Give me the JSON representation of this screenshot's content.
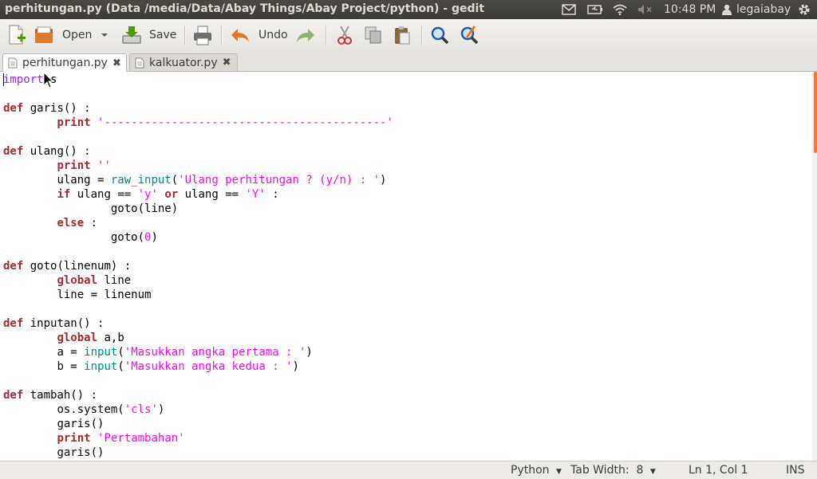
{
  "window": {
    "title": "perhitungan.py (Data /media/Data/Abay Things/Abay Project/python) - gedit"
  },
  "panel": {
    "icons": [
      "mail-icon",
      "battery-icon",
      "wifi-icon",
      "volume-muted-icon"
    ],
    "clock": "10:48 PM",
    "user": "legaiabay",
    "power_icon": "gear-icon"
  },
  "toolbar": {
    "new_icon": "new-document-icon",
    "open_label": "Open",
    "open_icon": "open-folder-icon",
    "save_label": "Save",
    "save_icon": "save-icon",
    "print_icon": "print-icon",
    "undo_label": "Undo",
    "undo_icon": "undo-arrow-icon",
    "redo_icon": "redo-arrow-icon",
    "cut_icon": "cut-icon",
    "copy_icon": "copy-icon",
    "paste_icon": "paste-icon",
    "find_icon": "find-icon",
    "replace_icon": "find-replace-icon"
  },
  "tabs": [
    {
      "label": "perhitungan.py",
      "active": true
    },
    {
      "label": "kalkuator.py",
      "active": false
    }
  ],
  "editor": {
    "lines": [
      [
        [
          "imp",
          "import"
        ],
        [
          "",
          "os"
        ]
      ],
      [],
      [
        [
          "kw",
          "def"
        ],
        [
          "",
          " garis() :"
        ]
      ],
      [
        [
          "",
          " "
        ],
        [
          "kw",
          "print"
        ],
        [
          "",
          " "
        ],
        [
          "str",
          "'------------------------------------------'"
        ]
      ],
      [],
      [
        [
          "kw",
          "def"
        ],
        [
          "",
          " ulang() :"
        ]
      ],
      [
        [
          "",
          " "
        ],
        [
          "kw",
          "print"
        ],
        [
          "",
          " "
        ],
        [
          "str",
          "''"
        ]
      ],
      [
        [
          "",
          " ulang = "
        ],
        [
          "bi",
          "raw_input"
        ],
        [
          "",
          "("
        ],
        [
          "str",
          "'Ulang perhitungan ? (y/n) : '"
        ],
        [
          "",
          ")"
        ]
      ],
      [
        [
          "",
          " "
        ],
        [
          "kw",
          "if"
        ],
        [
          "",
          " ulang == "
        ],
        [
          "str",
          "'y'"
        ],
        [
          "",
          " "
        ],
        [
          "kw",
          "or"
        ],
        [
          "",
          " ulang == "
        ],
        [
          "str",
          "'Y'"
        ],
        [
          "",
          " :"
        ]
      ],
      [
        [
          "",
          " goto(line)"
        ]
      ],
      [
        [
          "",
          " "
        ],
        [
          "kw",
          "else"
        ],
        [
          "",
          " :"
        ]
      ],
      [
        [
          "",
          " goto("
        ],
        [
          "num",
          "0"
        ],
        [
          "",
          ")"
        ]
      ],
      [],
      [
        [
          "kw",
          "def"
        ],
        [
          "",
          " goto(linenum) :"
        ]
      ],
      [
        [
          "",
          " "
        ],
        [
          "kw",
          "global"
        ],
        [
          "",
          " line"
        ]
      ],
      [
        [
          "",
          " line = linenum"
        ]
      ],
      [],
      [
        [
          "kw",
          "def"
        ],
        [
          "",
          " inputan() :"
        ]
      ],
      [
        [
          "",
          " "
        ],
        [
          "kw",
          "global"
        ],
        [
          "",
          " a,b"
        ]
      ],
      [
        [
          "",
          " a = "
        ],
        [
          "bi",
          "input"
        ],
        [
          "",
          "("
        ],
        [
          "str",
          "'Masukkan angka pertama : '"
        ],
        [
          "",
          ")"
        ]
      ],
      [
        [
          "",
          " b = "
        ],
        [
          "bi",
          "input"
        ],
        [
          "",
          "("
        ],
        [
          "str",
          "'Masukkan angka kedua : '"
        ],
        [
          "",
          ")"
        ]
      ],
      [],
      [
        [
          "kw",
          "def"
        ],
        [
          "",
          " tambah() :"
        ]
      ],
      [
        [
          "",
          " os.system("
        ],
        [
          "str",
          "'cls'"
        ],
        [
          "",
          ")"
        ]
      ],
      [
        [
          "",
          " garis()"
        ]
      ],
      [
        [
          "",
          " "
        ],
        [
          "kw",
          "print"
        ],
        [
          "",
          " "
        ],
        [
          "str",
          "'Pertambahan'"
        ]
      ],
      [
        [
          "",
          " garis()"
        ]
      ]
    ],
    "indents": [
      0,
      0,
      0,
      1,
      0,
      0,
      1,
      1,
      1,
      2,
      1,
      2,
      0,
      0,
      1,
      1,
      0,
      0,
      1,
      1,
      1,
      0,
      0,
      1,
      1,
      1,
      1
    ]
  },
  "statusbar": {
    "language": "Python",
    "tab_width": "Tab Width:  8",
    "position": "Ln 1, Col 1",
    "mode": "INS"
  }
}
